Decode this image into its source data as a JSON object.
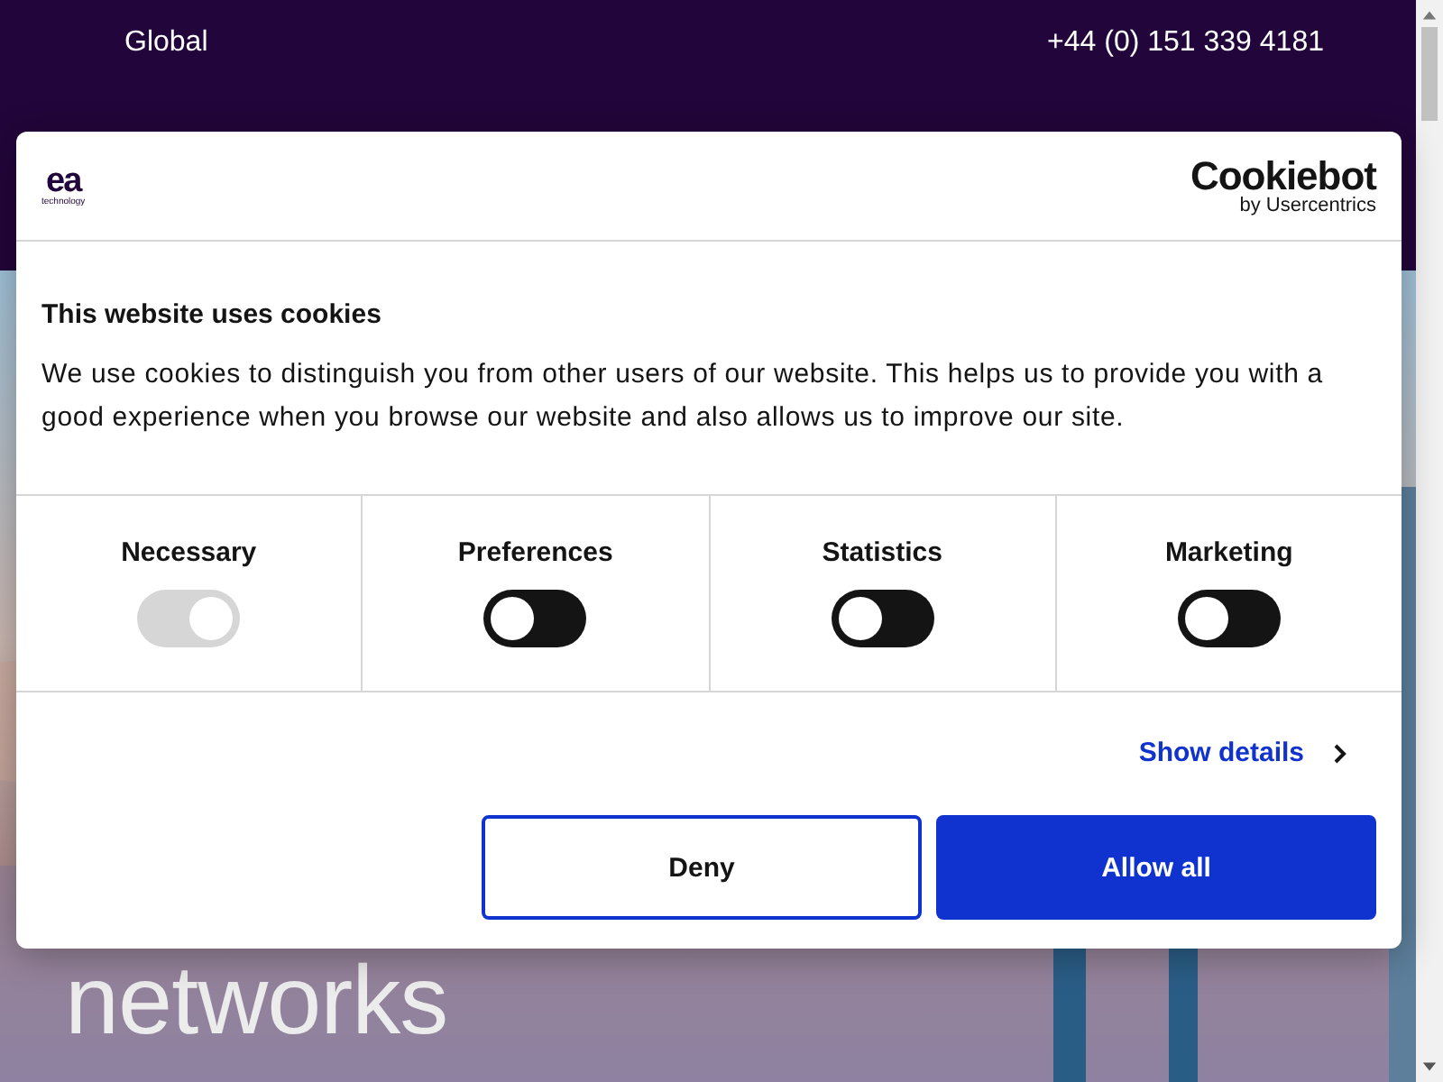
{
  "top_bar": {
    "region": "Global",
    "phone": "+44 (0) 151 339 4181"
  },
  "hero": {
    "kind": "picture",
    "heading": "networks"
  },
  "cookie_dialog": {
    "brand_logo": {
      "mark": "ea",
      "subtitle": "technology"
    },
    "provider_logo": {
      "name": "Cookiebot",
      "subtitle": "by Usercentrics"
    },
    "title": "This website uses cookies",
    "body": "We use cookies to distinguish you from other users of our website. This helps us to provide you with a good experience when you browse our website and also allows us to improve our site.",
    "categories": [
      {
        "label": "Necessary",
        "checked": true,
        "disabled": true
      },
      {
        "label": "Preferences",
        "checked": false,
        "disabled": false
      },
      {
        "label": "Statistics",
        "checked": false,
        "disabled": false
      },
      {
        "label": "Marketing",
        "checked": false,
        "disabled": false
      }
    ],
    "show_details": "Show details",
    "buttons": [
      {
        "label": "Deny",
        "kind": "outline"
      },
      {
        "label": "Allow all",
        "kind": "primary"
      }
    ]
  }
}
